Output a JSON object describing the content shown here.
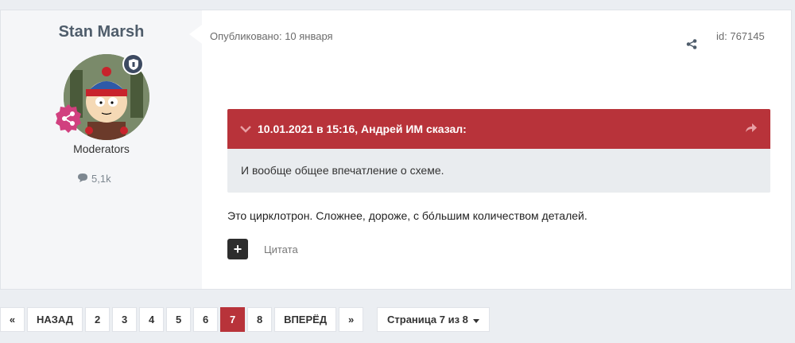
{
  "author": {
    "name": "Stan Marsh",
    "group": "Moderators",
    "posts_count": "5,1k"
  },
  "post": {
    "published": "Опубликовано: 10 января",
    "id_label": "id: 767145",
    "text": "Это цирклотрон. Сложнее, дороже, с бо́льшим количеством деталей.",
    "cite_label": "Цитата",
    "add_label": "+"
  },
  "quote": {
    "header": "10.01.2021 в 15:16, Андрей ИМ сказал:",
    "body": "И вообще общее впечатление о схеме."
  },
  "pagination": {
    "first": "«",
    "prev": "НАЗАД",
    "pages": [
      "2",
      "3",
      "4",
      "5",
      "6",
      "7",
      "8"
    ],
    "current": "7",
    "next": "ВПЕРЁД",
    "last": "»",
    "jump_label": "Страница 7 из 8"
  },
  "colors": {
    "accent": "#b8333a",
    "badge": "#3d4a61",
    "moderator_icon": "#d1407f"
  }
}
